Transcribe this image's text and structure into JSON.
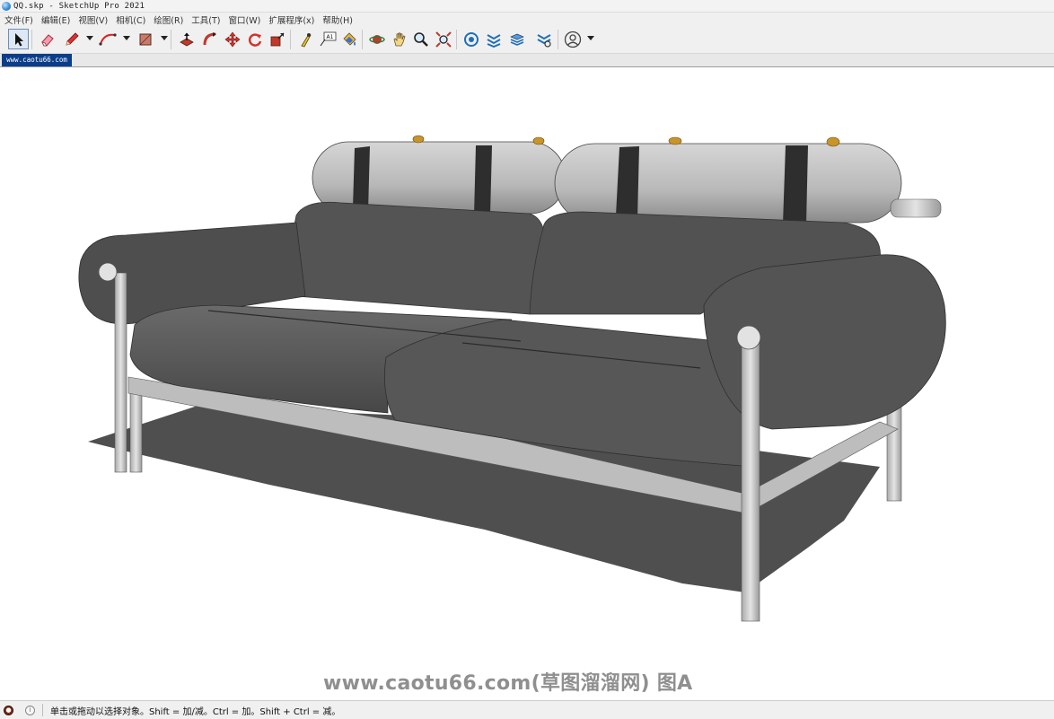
{
  "window": {
    "title": "QQ.skp - SketchUp Pro 2021"
  },
  "menu": [
    "文件(F)",
    "编辑(E)",
    "视图(V)",
    "相机(C)",
    "绘图(R)",
    "工具(T)",
    "窗口(W)",
    "扩展程序(x)",
    "帮助(H)"
  ],
  "toolbar": {
    "tools": [
      "select-arrow-icon",
      "eraser-icon",
      "pencil-icon",
      "arc-icon",
      "rectangle-icon",
      "push-pull-icon",
      "follow-me-icon",
      "move-icon",
      "rotate-icon",
      "scale-icon",
      "tape-measure-icon",
      "text-icon",
      "paint-bucket-icon",
      "orbit-icon",
      "pan-icon",
      "zoom-icon",
      "zoom-extents-icon",
      "warehouse-icon",
      "extension-warehouse-icon",
      "layout-icon",
      "extension-manager-icon",
      "account-icon"
    ],
    "text_tool_label": "A1"
  },
  "document_tab": {
    "label": "www.caotu66.com"
  },
  "watermark": {
    "text": "www.caotu66.com(草图溜溜网) 图A"
  },
  "status": {
    "text": "单击或拖动以选择对象。Shift = 加/减。Ctrl = 加。Shift + Ctrl = 减。"
  },
  "colors": {
    "accent": "#0b3d8a",
    "sofa_body": "#585858",
    "sofa_shadow": "#4a4a4a",
    "pillow": "#bdbdbd",
    "strap": "#2e2e2e",
    "frame": "#c8c8c8",
    "knob": "#c8952a"
  }
}
